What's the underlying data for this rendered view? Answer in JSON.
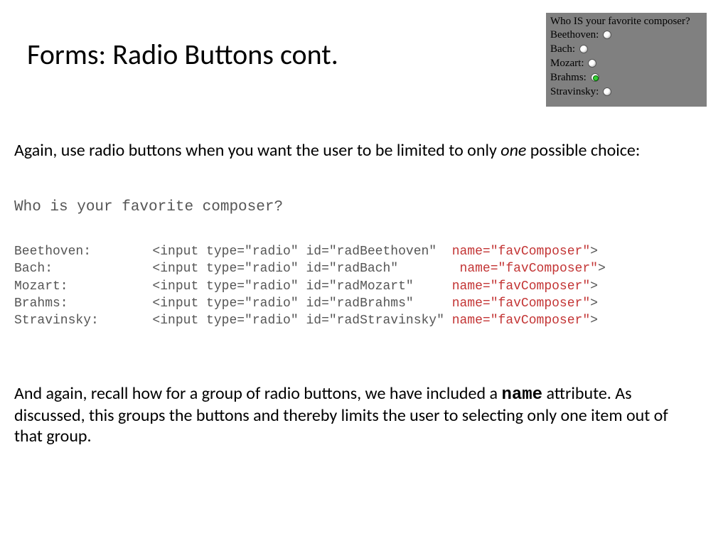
{
  "title": "Forms: Radio Buttons cont.",
  "preview": {
    "question": "Who IS your favorite composer?",
    "options": [
      {
        "label": "Beethoven:",
        "selected": false
      },
      {
        "label": "Bach:",
        "selected": false
      },
      {
        "label": "Mozart:",
        "selected": false
      },
      {
        "label": "Brahms:",
        "selected": true
      },
      {
        "label": "Stravinsky:",
        "selected": false
      }
    ]
  },
  "intro": {
    "before": "Again, use radio buttons when you want the user to be limited to only ",
    "em": "one",
    "after": " possible choice:"
  },
  "code": {
    "question": "Who is your favorite composer?",
    "lines": [
      {
        "label": "Beethoven:",
        "pad": 5,
        "inp": "<input type=\"radio\" id=\"radBeethoven\"",
        "inpPad": 2,
        "name": "name=\"favComposer\"",
        "tail": ">"
      },
      {
        "label": "Bach:",
        "pad": 10,
        "inp": "<input type=\"radio\" id=\"radBach\"",
        "inpPad": 8,
        "name": "name=\"favComposer\"",
        "tail": ">"
      },
      {
        "label": "Mozart:",
        "pad": 8,
        "inp": "<input type=\"radio\" id=\"radMozart\"",
        "inpPad": 5,
        "name": "name=\"favComposer\"",
        "tail": ">"
      },
      {
        "label": "Brahms:",
        "pad": 8,
        "inp": "<input type=\"radio\" id=\"radBrahms\"",
        "inpPad": 5,
        "name": "name=\"favComposer\"",
        "tail": ">"
      },
      {
        "label": "Stravinsky:",
        "pad": 4,
        "inp": "<input type=\"radio\" id=\"radStravinsky\"",
        "inpPad": 1,
        "name": "name=\"favComposer\"",
        "tail": ">"
      }
    ]
  },
  "outro": {
    "before": "And again, recall how for a group of radio buttons, we have included a ",
    "mono": "name",
    "after": " attribute. As discussed, this groups the buttons and thereby limits the user to selecting only one item out of that group."
  }
}
